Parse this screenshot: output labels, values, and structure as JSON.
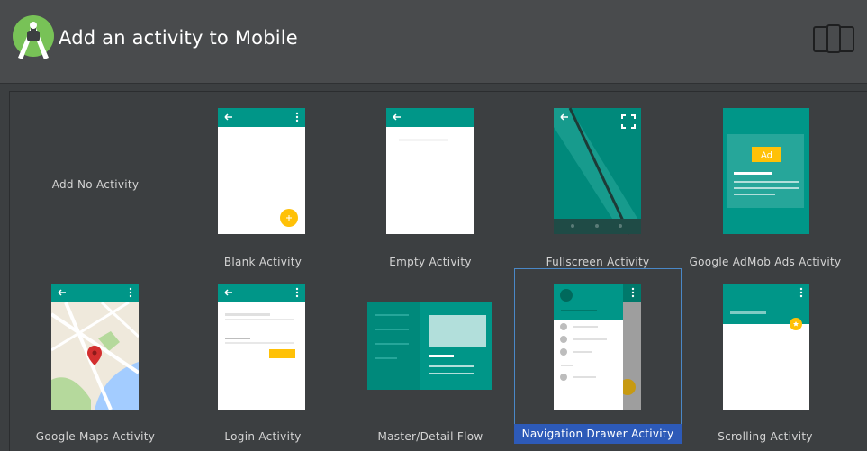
{
  "header": {
    "title": "Add an activity to Mobile",
    "logo_icon": "android-studio-logo",
    "device_icon": "tablet-phone-icon"
  },
  "colors": {
    "teal_dark": "#009688",
    "teal_light": "#26a69a",
    "amber": "#ffc107",
    "selection_blue": "#2d5ab8"
  },
  "templates": [
    {
      "label": "Add No Activity",
      "selected": false
    },
    {
      "label": "Blank Activity",
      "selected": false
    },
    {
      "label": "Empty Activity",
      "selected": false
    },
    {
      "label": "Fullscreen Activity",
      "selected": false
    },
    {
      "label": "Google AdMob Ads Activity",
      "selected": false,
      "ad_badge": "Ad"
    },
    {
      "label": "Google Maps Activity",
      "selected": false
    },
    {
      "label": "Login Activity",
      "selected": false
    },
    {
      "label": "Master/Detail Flow",
      "selected": false
    },
    {
      "label": "Navigation Drawer Activity",
      "selected": true
    },
    {
      "label": "Scrolling Activity",
      "selected": false
    }
  ]
}
